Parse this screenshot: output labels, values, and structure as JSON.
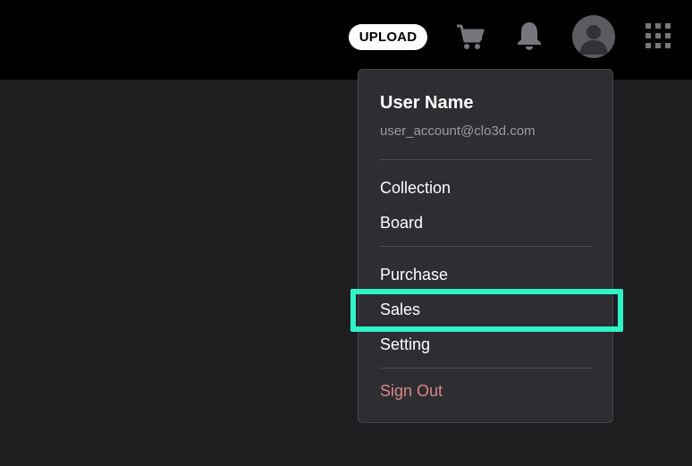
{
  "header": {
    "upload_label": "UPLOAD",
    "icons": [
      "cart-icon",
      "bell-icon",
      "avatar",
      "apps-grid-icon"
    ]
  },
  "menu": {
    "user_name": "User Name",
    "user_email": "user_account@clo3d.com",
    "items": [
      {
        "label": "Collection"
      },
      {
        "label": "Board"
      },
      {
        "label": "Purchase"
      },
      {
        "label": "Sales"
      },
      {
        "label": "Setting"
      },
      {
        "label": "Sign Out"
      }
    ]
  },
  "colors": {
    "topbar": "#000000",
    "background": "#1e1e21",
    "menu_bg": "#2e2d32",
    "highlight": "#2ef5c8",
    "signout": "#d98585",
    "icon_gray": "#77767c"
  }
}
